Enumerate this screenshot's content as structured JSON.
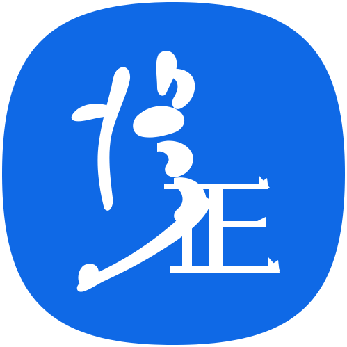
{
  "icon": {
    "name": "app-logo-icon",
    "logo_text": "修正",
    "background_color": "#0f69e6",
    "glyph_color": "#ffffff"
  }
}
